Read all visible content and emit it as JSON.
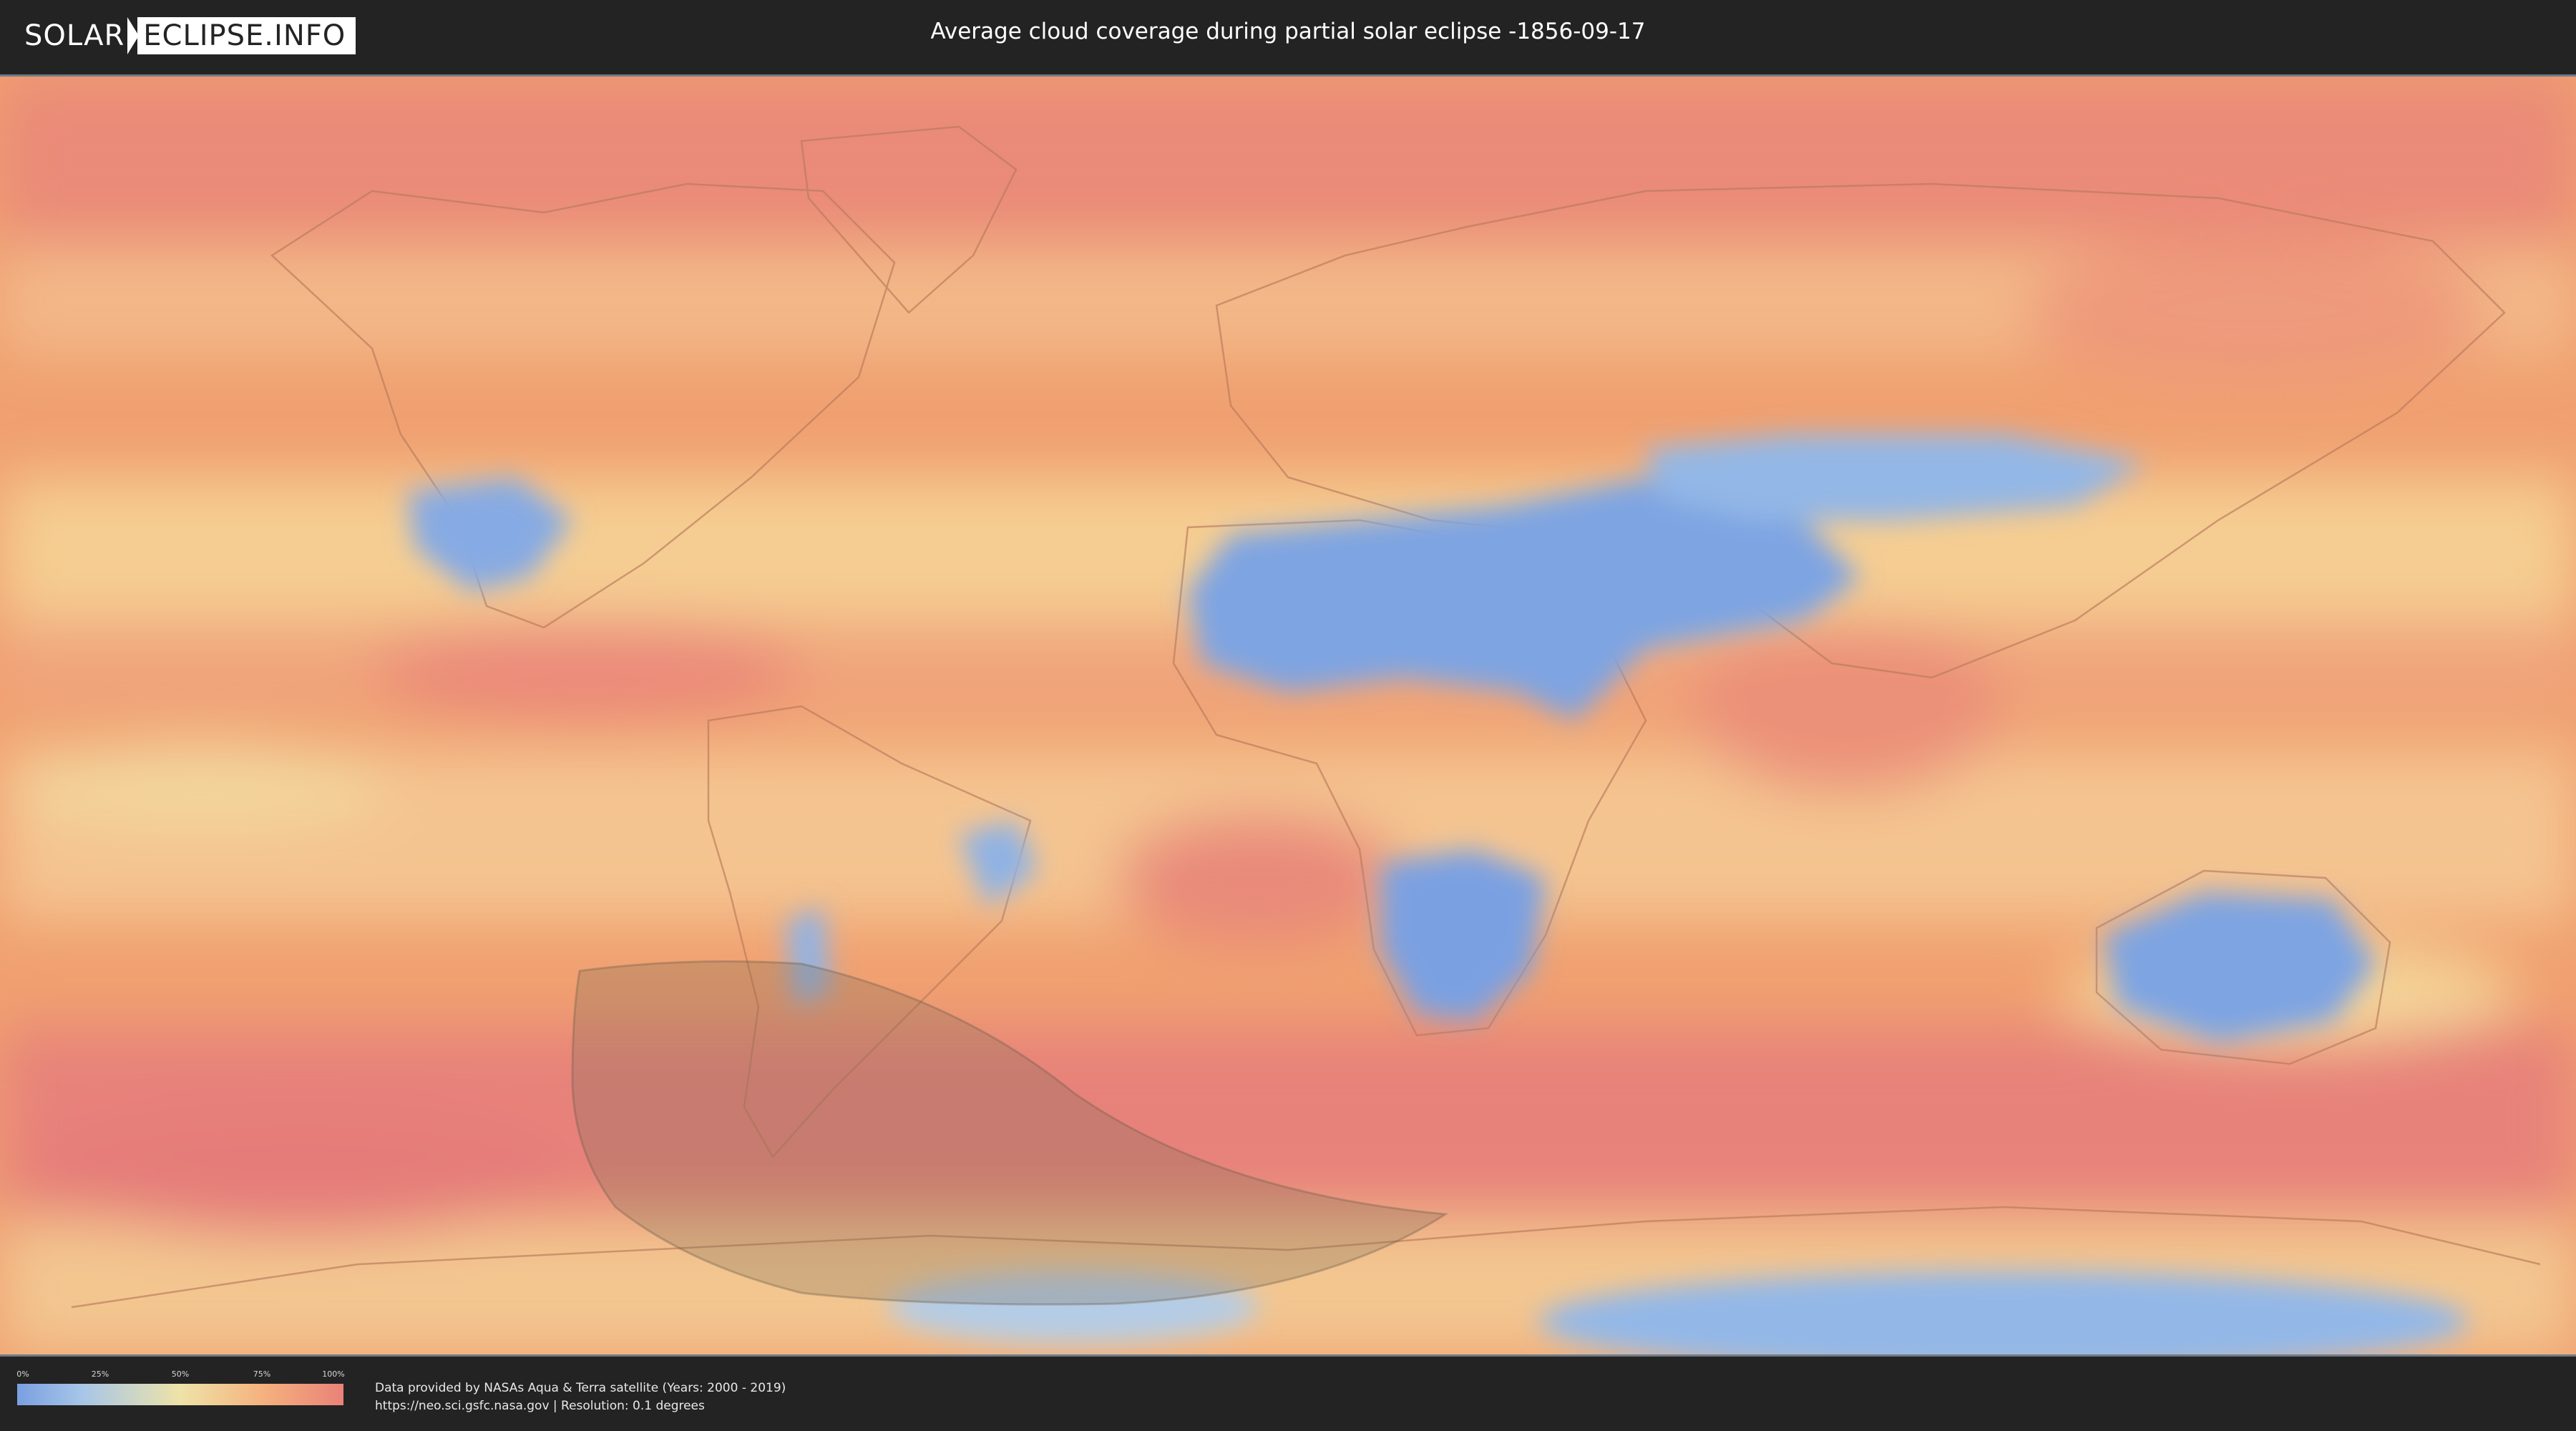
{
  "header": {
    "logo_left": "SOLAR",
    "logo_right": "ECLIPSE.INFO",
    "title": "Average cloud coverage during partial solar eclipse -1856-09-17"
  },
  "map": {
    "colors": {
      "ocean_base": "#f0a070",
      "high_cloud": "#e9857a",
      "medium_cloud": "#f5c088",
      "low_cloud": "#eee3a8",
      "very_low_cloud": "#7ea2e2",
      "eclipse_zone": "#7a6a55"
    }
  },
  "legend": {
    "ticks": [
      "0%",
      "25%",
      "50%",
      "75%",
      "100%"
    ]
  },
  "credits": {
    "line1": "Data provided by NASAs Aqua & Terra satellite (Years: 2000 - 2019)",
    "line2": "https://neo.sci.gsfc.nasa.gov | Resolution: 0.1 degrees"
  }
}
